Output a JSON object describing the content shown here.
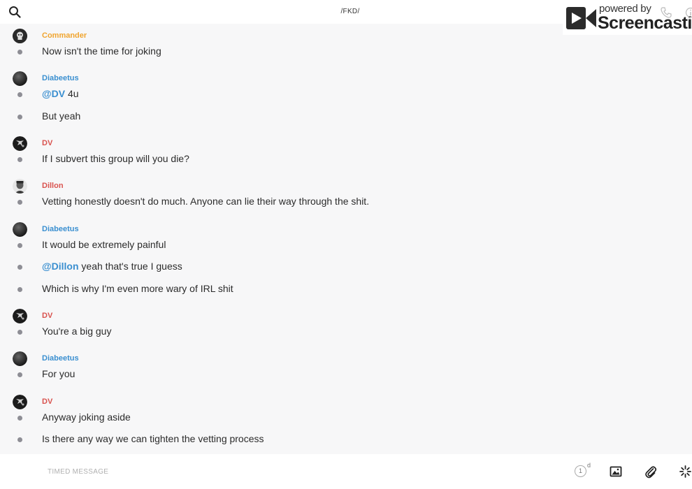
{
  "header": {
    "room_title": "/FKD/"
  },
  "watermark": {
    "powered": "powered by",
    "brand": "Screencastify"
  },
  "colors": {
    "commander": "#f0a530",
    "diabeetus": "#3a8fd0",
    "dv": "#d9534f",
    "dillon": "#d9534f"
  },
  "messages": [
    {
      "sender": "Commander",
      "lines": [
        "Now isn't the time for joking"
      ]
    },
    {
      "sender": "Diabeetus",
      "lines": [
        {
          "mention": "@DV",
          "rest": " 4u"
        },
        "But yeah"
      ]
    },
    {
      "sender": "DV",
      "lines": [
        "If I subvert this group will you die?"
      ]
    },
    {
      "sender": "Dillon",
      "lines": [
        "Vetting honestly doesn't do much. Anyone can lie their way through the shit."
      ]
    },
    {
      "sender": "Diabeetus",
      "lines": [
        "It would be extremely painful",
        {
          "mention": "@Dillon",
          "rest": " yeah that's true I guess"
        },
        "Which is why I'm even more wary of IRL shit"
      ]
    },
    {
      "sender": "DV",
      "lines": [
        "You're a big guy"
      ]
    },
    {
      "sender": "Diabeetus",
      "lines": [
        "For you"
      ]
    },
    {
      "sender": "DV",
      "lines": [
        "Anyway joking aside",
        "Is there any way we can tighten the vetting process"
      ]
    }
  ],
  "composer": {
    "placeholder": "TIMED MESSAGE",
    "timer_value": "1",
    "timer_unit": "d"
  }
}
